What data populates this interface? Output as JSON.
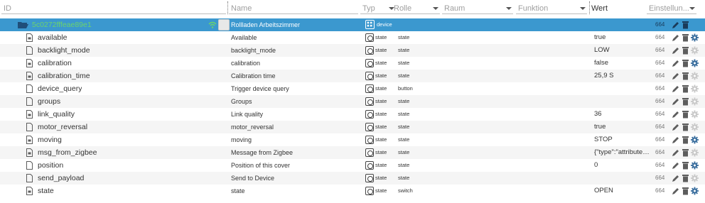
{
  "header": {
    "id": "ID",
    "name": "Name",
    "typ": "Typ",
    "rolle": "Rolle",
    "raum": "Raum",
    "funktion": "Funktion",
    "wert": "Wert",
    "einstellungen": "Einstellun..."
  },
  "colors": {
    "selected_row": "#3b98cf",
    "id_green": "#6cd36c",
    "icon": "#5d5d5d",
    "gear_blue": "#3a6e9e",
    "gear_grey": "#c9c9c9"
  },
  "folder": {
    "id": "5c0272fffeae89e1",
    "name": "Rollladen Arbeitszimmer",
    "type": "device",
    "acl": "664"
  },
  "rows": [
    {
      "id": "available",
      "name": "Available",
      "type": "state",
      "role": "state",
      "value": "true",
      "acl": "664",
      "gear": "active"
    },
    {
      "id": "backlight_mode",
      "name": "backlight_mode",
      "type": "state",
      "role": "state",
      "value": "LOW",
      "acl": "664",
      "gear": "inactive"
    },
    {
      "id": "calibration",
      "name": "calibration",
      "type": "state",
      "role": "state",
      "value": "false",
      "acl": "664",
      "gear": "active"
    },
    {
      "id": "calibration_time",
      "name": "Calibration time",
      "type": "state",
      "role": "state",
      "value": "25,9 S",
      "acl": "664",
      "gear": "inactive"
    },
    {
      "id": "device_query",
      "name": "Trigger device query",
      "type": "state",
      "role": "button",
      "value": "",
      "acl": "664",
      "gear": "inactive"
    },
    {
      "id": "groups",
      "name": "Groups",
      "type": "state",
      "role": "state",
      "value": "",
      "acl": "664",
      "gear": "inactive"
    },
    {
      "id": "link_quality",
      "name": "Link quality",
      "type": "state",
      "role": "state",
      "value": "36",
      "acl": "664",
      "gear": "inactive"
    },
    {
      "id": "motor_reversal",
      "name": "motor_reversal",
      "type": "state",
      "role": "state",
      "value": "true",
      "acl": "664",
      "gear": "inactive"
    },
    {
      "id": "moving",
      "name": "moving",
      "type": "state",
      "role": "state",
      "value": "STOP",
      "acl": "664",
      "gear": "active"
    },
    {
      "id": "msg_from_zigbee",
      "name": "Message from Zigbee",
      "type": "state",
      "role": "state",
      "value": "{\"type\":\"attributeR...",
      "acl": "664",
      "gear": "inactive"
    },
    {
      "id": "position",
      "name": "Position of this cover",
      "type": "state",
      "role": "state",
      "value": "0",
      "acl": "664",
      "gear": "active"
    },
    {
      "id": "send_payload",
      "name": "Send to Device",
      "type": "state",
      "role": "state",
      "value": "",
      "acl": "664",
      "gear": "inactive"
    },
    {
      "id": "state",
      "name": "state",
      "type": "state",
      "role": "switch",
      "value": "OPEN",
      "acl": "664",
      "gear": "active"
    }
  ]
}
